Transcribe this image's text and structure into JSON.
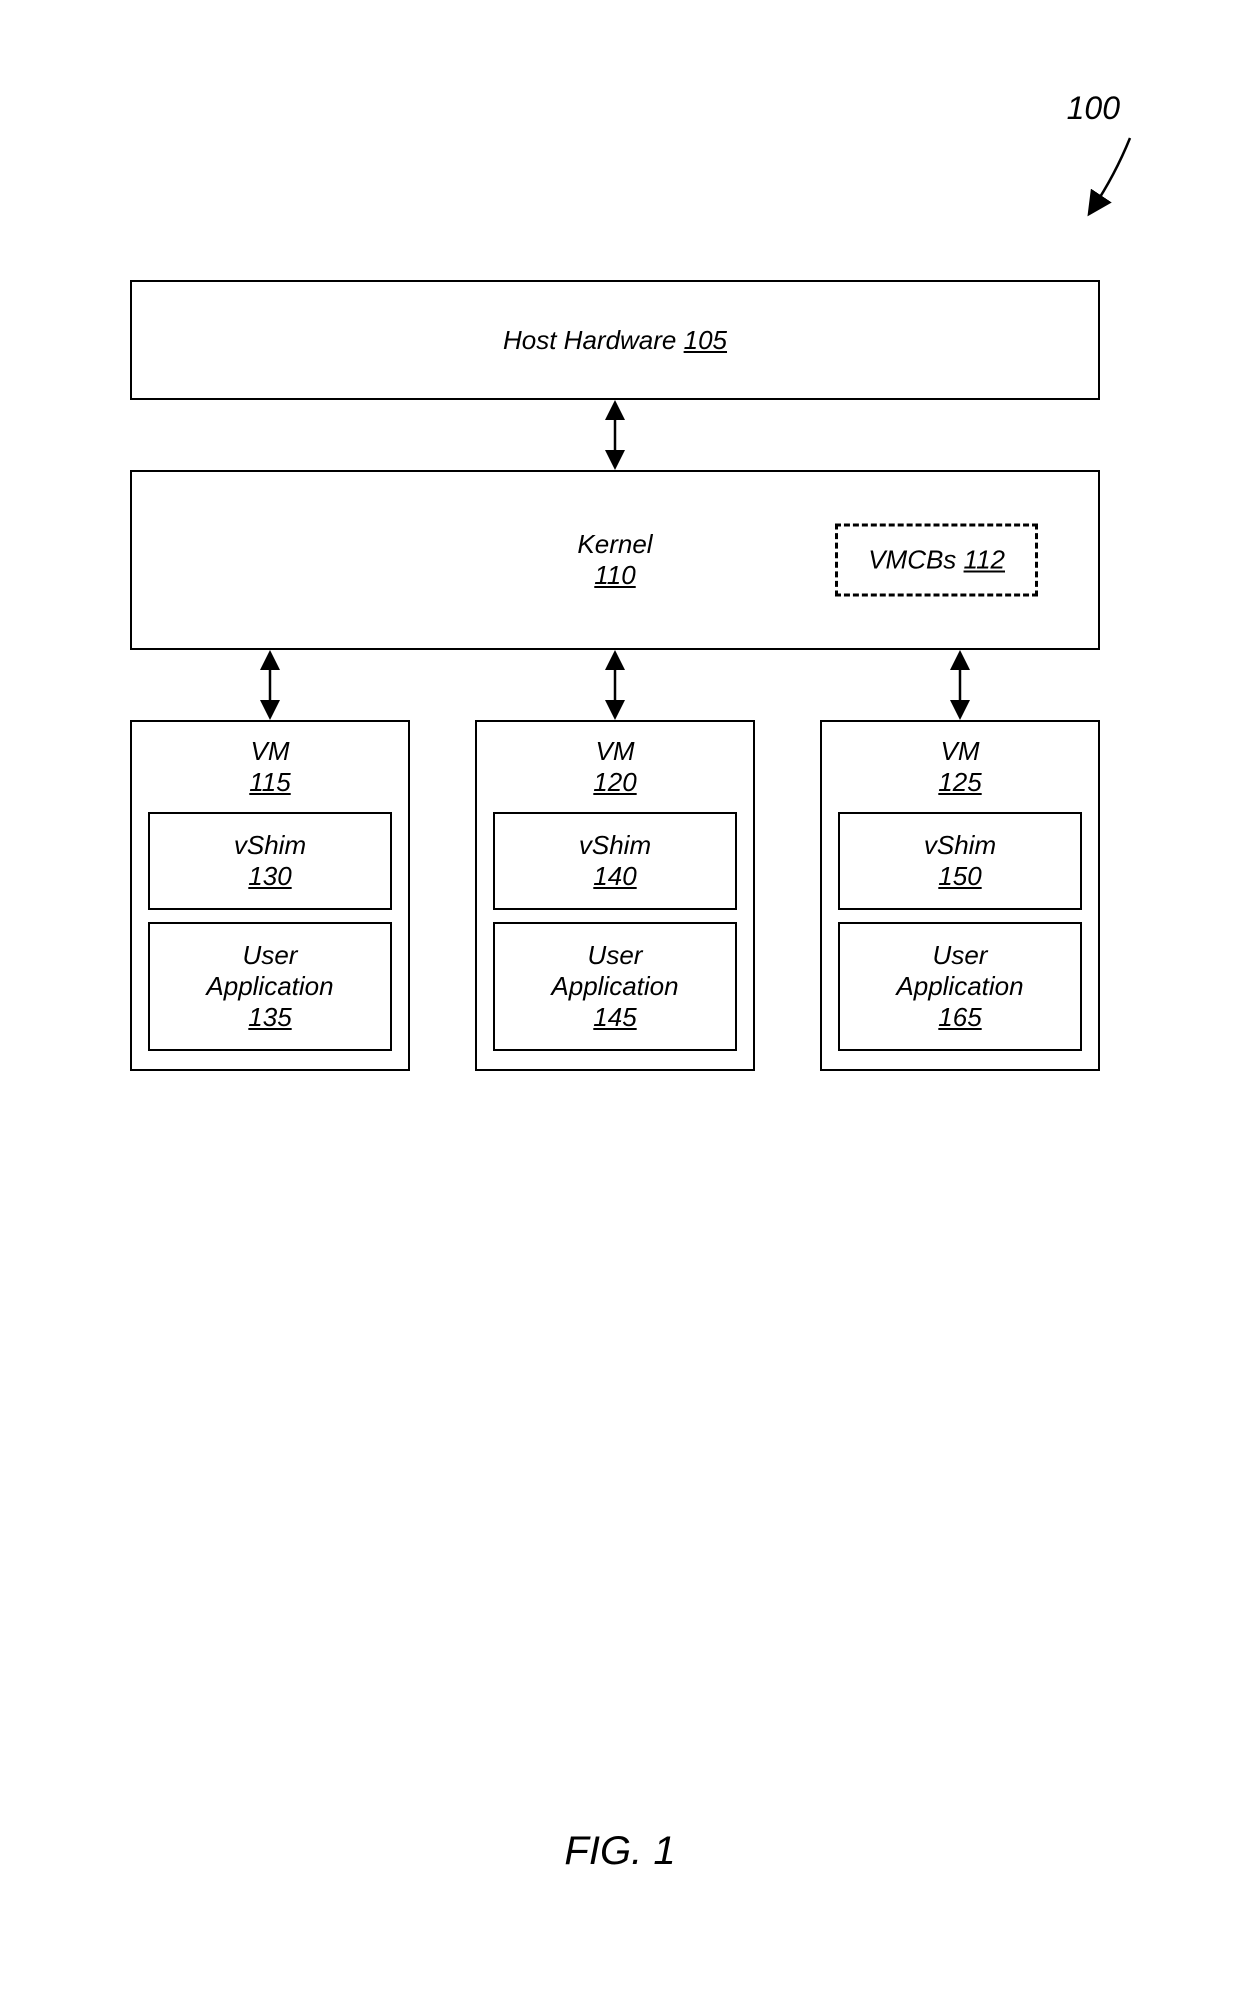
{
  "figure_ref": "100",
  "figure_label": "FIG. 1",
  "host_hardware": {
    "label": "Host Hardware",
    "ref": "105"
  },
  "kernel": {
    "label": "Kernel",
    "ref": "110"
  },
  "vmcbs": {
    "label": "VMCBs",
    "ref": "112"
  },
  "vms": [
    {
      "label": "VM",
      "ref": "115",
      "vshim": {
        "label": "vShim",
        "ref": "130"
      },
      "app": {
        "label": "User Application",
        "ref": "135"
      }
    },
    {
      "label": "VM",
      "ref": "120",
      "vshim": {
        "label": "vShim",
        "ref": "140"
      },
      "app": {
        "label": "User Application",
        "ref": "145"
      }
    },
    {
      "label": "VM",
      "ref": "125",
      "vshim": {
        "label": "vShim",
        "ref": "150"
      },
      "app": {
        "label": "User Application",
        "ref": "165"
      }
    }
  ]
}
